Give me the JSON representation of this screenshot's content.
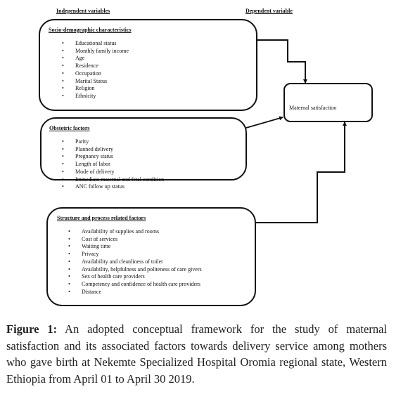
{
  "headers": {
    "independent": "Independent variables",
    "dependent": "Dependent variable"
  },
  "boxes": {
    "sociodemographic": {
      "title": "Socio-demographic characteristics",
      "items": [
        "Educational status",
        "Monthly family income",
        "Age",
        "Residence",
        "Occupation",
        "Marital Status",
        "Religion",
        "Ethnicity"
      ]
    },
    "obstetric": {
      "title": "Obstetric factors",
      "items": [
        "Parity",
        "Planned delivery",
        "Pregnancy status",
        "Length of labor",
        "Mode of delivery",
        "Immediate maternal and fetal condition",
        "ANC follow up status"
      ]
    },
    "structure": {
      "title": "Structure and process related factors",
      "items": [
        "Availability of supplies and rooms",
        "Cost of services",
        "Waiting time",
        "Privacy",
        "Availability and cleanliness of toilet",
        "Availability, helpfulness and politeness of care givers",
        "Sex of health care providers",
        "Competency and confidence of health care providers",
        "Distance"
      ]
    },
    "outcome": {
      "label": "Maternal satisfaction"
    }
  },
  "connections": [
    {
      "from": "sociodemographic",
      "to": "outcome"
    },
    {
      "from": "obstetric",
      "to": "outcome"
    },
    {
      "from": "structure",
      "to": "outcome"
    }
  ],
  "caption": {
    "label": "Figure 1:",
    "text": " An adopted conceptual framework for the study of maternal satisfaction and its associated factors towards delivery service among mothers who gave birth at Nekemte Specialized Hospital Oromia regional state, Western Ethiopia from April 01 to April 30 2019."
  }
}
